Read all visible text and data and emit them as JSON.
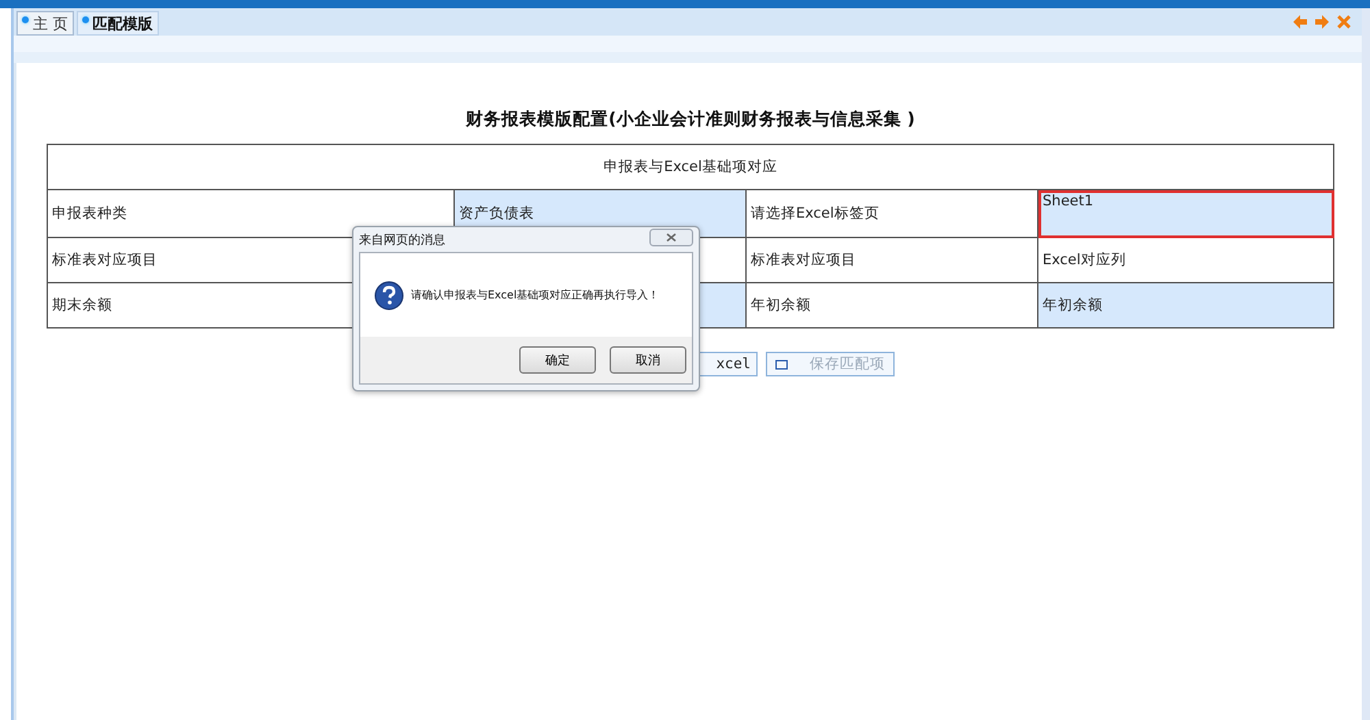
{
  "tabs": [
    {
      "label": "主 页",
      "selected": false
    },
    {
      "label": "匹配模版",
      "selected": true
    }
  ],
  "title": "财务报表模版配置(小企业会计准则财务报表与信息采集 )",
  "table": {
    "header": "申报表与Excel基础项对应",
    "rows": [
      [
        {
          "text": "申报表种类",
          "highlighted": false,
          "focused": false
        },
        {
          "text": "资产负债表",
          "highlighted": true,
          "focused": false
        },
        {
          "text": "请选择Excel标签页",
          "highlighted": false,
          "focused": false
        },
        {
          "text": "Sheet1",
          "highlighted": true,
          "focused": true
        }
      ],
      [
        {
          "text": "标准表对应项目",
          "highlighted": false,
          "focused": false
        },
        {
          "highlighted": false,
          "focused": false
        },
        {
          "text": "标准表对应项目",
          "highlighted": false,
          "focused": false
        },
        {
          "text": "Excel对应列",
          "highlighted": false,
          "focused": false
        }
      ],
      [
        {
          "text": "期末余额",
          "highlighted": false,
          "focused": false
        },
        {
          "highlighted": true,
          "focused": false
        },
        {
          "text": "年初余额",
          "highlighted": false,
          "focused": false
        },
        {
          "text": "年初余额",
          "highlighted": true,
          "focused": false
        }
      ]
    ]
  },
  "buttons": [
    {
      "label": "xcel",
      "disabled": false
    },
    {
      "label": "保存匹配项",
      "disabled": true
    }
  ],
  "dialog": {
    "title": "来自网页的消息",
    "message": "请确认申报表与Excel基础项对应正确再执行导入！",
    "buttons": [
      "确定",
      "取消"
    ]
  }
}
